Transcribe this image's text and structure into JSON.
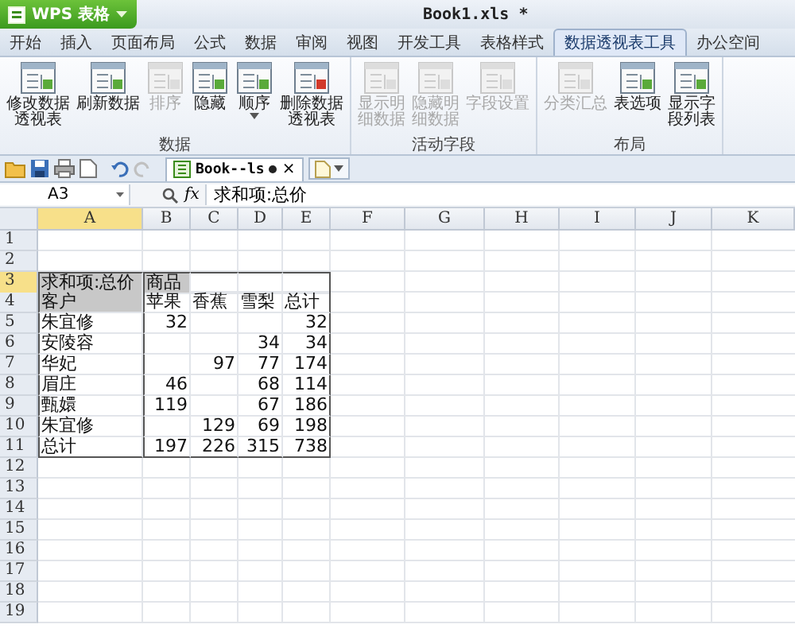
{
  "app_button": {
    "label": "WPS 表格"
  },
  "window": {
    "title": "Book1.xls *"
  },
  "tabs": [
    {
      "label": "开始",
      "selected": false
    },
    {
      "label": "插入",
      "selected": false
    },
    {
      "label": "页面布局",
      "selected": false
    },
    {
      "label": "公式",
      "selected": false
    },
    {
      "label": "数据",
      "selected": false
    },
    {
      "label": "审阅",
      "selected": false
    },
    {
      "label": "视图",
      "selected": false
    },
    {
      "label": "开发工具",
      "selected": false
    },
    {
      "label": "表格样式",
      "selected": false
    },
    {
      "label": "数据透视表工具",
      "selected": true
    },
    {
      "label": "办公空间",
      "selected": false
    }
  ],
  "ribbon_groups": [
    {
      "label": "数据",
      "buttons": [
        {
          "lines": [
            "修改数据",
            "透视表"
          ],
          "disabled": false,
          "dropdown": false
        },
        {
          "lines": [
            "刷新数据"
          ],
          "disabled": false,
          "dropdown": false
        },
        {
          "lines": [
            "排序"
          ],
          "disabled": true,
          "dropdown": false
        },
        {
          "lines": [
            "隐藏"
          ],
          "disabled": false,
          "dropdown": false
        },
        {
          "lines": [
            "顺序"
          ],
          "disabled": false,
          "dropdown": true
        },
        {
          "lines": [
            "删除数据",
            "透视表"
          ],
          "disabled": false,
          "dropdown": false
        }
      ]
    },
    {
      "label": "活动字段",
      "buttons": [
        {
          "lines": [
            "显示明",
            "细数据"
          ],
          "disabled": true,
          "dropdown": false
        },
        {
          "lines": [
            "隐藏明",
            "细数据"
          ],
          "disabled": true,
          "dropdown": false
        },
        {
          "lines": [
            "字段设置"
          ],
          "disabled": true,
          "dropdown": false
        }
      ]
    },
    {
      "label": "布局",
      "buttons": [
        {
          "lines": [
            "分类汇总"
          ],
          "disabled": true,
          "dropdown": false
        },
        {
          "lines": [
            "表选项"
          ],
          "disabled": false,
          "dropdown": false
        },
        {
          "lines": [
            "显示字",
            "段列表"
          ],
          "disabled": false,
          "dropdown": false
        }
      ]
    }
  ],
  "document_tab": {
    "title": "Book--ls",
    "modified": true,
    "close": "×"
  },
  "formula_bar": {
    "name_box": "A3",
    "function_label": "fx",
    "value": "求和项:总价"
  },
  "sheet": {
    "columns": [
      {
        "label": "A",
        "selected": true
      },
      {
        "label": "B",
        "selected": false
      },
      {
        "label": "C",
        "selected": false
      },
      {
        "label": "D",
        "selected": false
      },
      {
        "label": "E",
        "selected": false
      },
      {
        "label": "F",
        "selected": false
      },
      {
        "label": "G",
        "selected": false
      },
      {
        "label": "H",
        "selected": false
      },
      {
        "label": "I",
        "selected": false
      },
      {
        "label": "J",
        "selected": false
      },
      {
        "label": "K",
        "selected": false
      }
    ],
    "rows": [
      {
        "number": "1",
        "selected": false
      },
      {
        "number": "2",
        "selected": false
      },
      {
        "number": "3",
        "selected": true,
        "cells": [
          {
            "text": "求和项:总价",
            "kind": "field"
          },
          {
            "text": "商品",
            "kind": "field"
          },
          null,
          null,
          null
        ]
      },
      {
        "number": "4",
        "selected": false,
        "cells": [
          {
            "text": "客户",
            "kind": "field"
          },
          {
            "text": "苹果",
            "kind": "label"
          },
          {
            "text": "香蕉",
            "kind": "label"
          },
          {
            "text": "雪梨",
            "kind": "label"
          },
          {
            "text": "总计",
            "kind": "label"
          }
        ]
      },
      {
        "number": "5",
        "selected": false,
        "cells": [
          {
            "text": "朱宜修",
            "kind": "label"
          },
          {
            "text": "32",
            "kind": "number"
          },
          null,
          null,
          {
            "text": "32",
            "kind": "number"
          }
        ]
      },
      {
        "number": "6",
        "selected": false,
        "cells": [
          {
            "text": "安陵容",
            "kind": "label"
          },
          null,
          null,
          {
            "text": "34",
            "kind": "number"
          },
          {
            "text": "34",
            "kind": "number"
          }
        ]
      },
      {
        "number": "7",
        "selected": false,
        "cells": [
          {
            "text": "华妃",
            "kind": "label"
          },
          null,
          {
            "text": "97",
            "kind": "number"
          },
          {
            "text": "77",
            "kind": "number"
          },
          {
            "text": "174",
            "kind": "number"
          }
        ]
      },
      {
        "number": "8",
        "selected": false,
        "cells": [
          {
            "text": "眉庄",
            "kind": "label"
          },
          {
            "text": "46",
            "kind": "number"
          },
          null,
          {
            "text": "68",
            "kind": "number"
          },
          {
            "text": "114",
            "kind": "number"
          }
        ]
      },
      {
        "number": "9",
        "selected": false,
        "cells": [
          {
            "text": "甄嬛",
            "kind": "label"
          },
          {
            "text": "119",
            "kind": "number"
          },
          null,
          {
            "text": "67",
            "kind": "number"
          },
          {
            "text": "186",
            "kind": "number"
          }
        ]
      },
      {
        "number": "10",
        "selected": false,
        "cells": [
          {
            "text": "朱宜修",
            "kind": "label"
          },
          null,
          {
            "text": "129",
            "kind": "number"
          },
          {
            "text": "69",
            "kind": "number"
          },
          {
            "text": "198",
            "kind": "number"
          }
        ]
      },
      {
        "number": "11",
        "selected": false,
        "cells": [
          {
            "text": "总计",
            "kind": "label"
          },
          {
            "text": "197",
            "kind": "number"
          },
          {
            "text": "226",
            "kind": "number"
          },
          {
            "text": "315",
            "kind": "number"
          },
          {
            "text": "738",
            "kind": "number"
          }
        ]
      },
      {
        "number": "12",
        "selected": false
      },
      {
        "number": "13",
        "selected": false
      },
      {
        "number": "14",
        "selected": false
      },
      {
        "number": "15",
        "selected": false
      },
      {
        "number": "16",
        "selected": false
      },
      {
        "number": "17",
        "selected": false
      },
      {
        "number": "18",
        "selected": false
      },
      {
        "number": "19",
        "selected": false
      }
    ]
  }
}
